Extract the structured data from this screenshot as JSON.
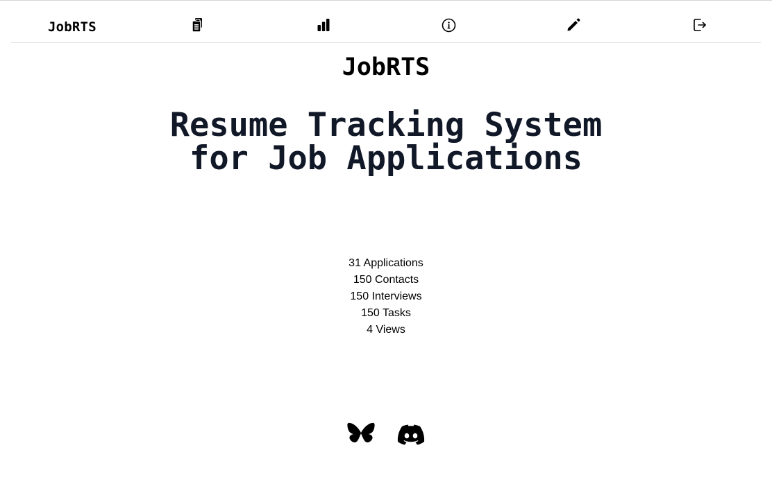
{
  "nav": {
    "brand": "JobRTS",
    "icons": [
      {
        "name": "applications-icon"
      },
      {
        "name": "stats-icon"
      },
      {
        "name": "info-icon"
      },
      {
        "name": "edit-icon"
      },
      {
        "name": "logout-icon"
      }
    ]
  },
  "hero": {
    "brand": "JobRTS",
    "headline_line1": "Resume Tracking System",
    "headline_line2": "for Job Applications"
  },
  "stats": [
    "31 Applications",
    "150 Contacts",
    "150 Interviews",
    "150 Tasks",
    "4 Views"
  ],
  "socials": [
    {
      "name": "bluesky-icon"
    },
    {
      "name": "discord-icon"
    }
  ],
  "colors": {
    "headline": "#111827",
    "text": "#000000",
    "divider": "#e5e5e5"
  }
}
